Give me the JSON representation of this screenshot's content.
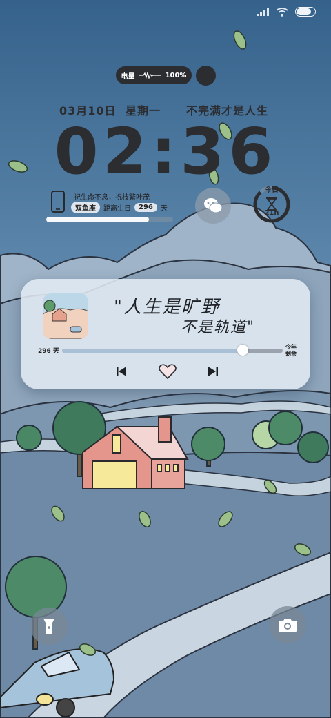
{
  "status_bar": {
    "signal_icon": "signal-bars-icon",
    "wifi_icon": "wifi-icon",
    "battery_level": 0.82
  },
  "battery_widget": {
    "label": "电量",
    "percent_text": "100%"
  },
  "date_line": {
    "date": "03月10日",
    "weekday": "星期一",
    "motto": "不完满才是人生"
  },
  "clock": {
    "time": "02:36"
  },
  "birthday": {
    "line1": "祝生命不息，祝枝繁叶茂",
    "zodiac": "双鱼座",
    "until_label": "距离生日",
    "days": "296",
    "unit": "天",
    "progress": 0.81
  },
  "hourglass": {
    "top_label": "今日",
    "hours": "21h",
    "progress": 0.88
  },
  "music_card": {
    "quote_line1": "\"人生是旷野",
    "quote_line2": "不是轨道\"",
    "days_label": "296 天",
    "year_label_1": "今年",
    "year_label_2": "剩余",
    "progress": 0.82
  },
  "colors": {
    "sky_top": "#3b6890",
    "sky_bottom": "#7a9dbb",
    "hills": "#7f9ab3",
    "ground": "#6c87a3",
    "dark_text": "#2b2d31"
  }
}
